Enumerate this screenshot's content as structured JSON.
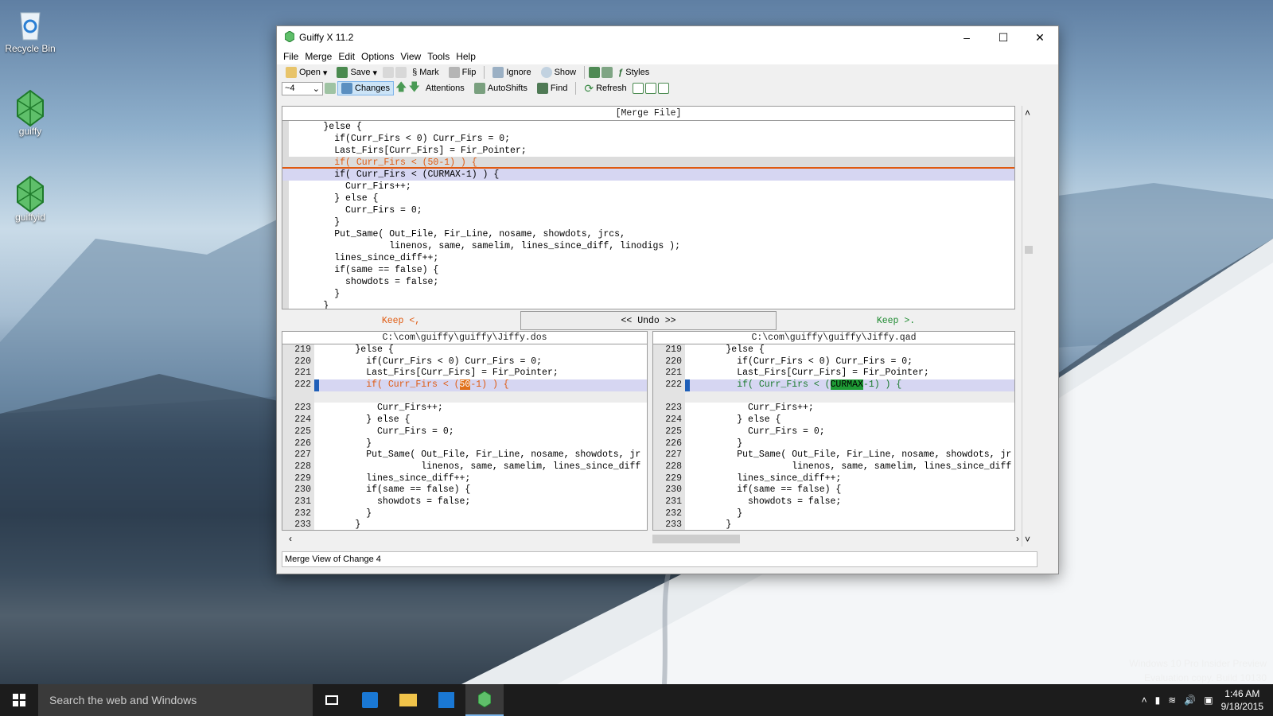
{
  "desktop": {
    "icons": [
      {
        "label": "Recycle Bin",
        "icon": "recycle-bin-icon"
      },
      {
        "label": "guiffy",
        "icon": "guiffy-icon"
      },
      {
        "label": "guiffyid",
        "icon": "guiffy-icon"
      }
    ],
    "watermark": [
      "Windows 10 Pro Insider Preview",
      "Evaluation copy. Build 10130"
    ]
  },
  "window": {
    "title": "Guiffy X 11.2",
    "menu": [
      "File",
      "Merge",
      "Edit",
      "Options",
      "View",
      "Tools",
      "Help"
    ],
    "toolbar1": {
      "open": "Open",
      "save": "Save",
      "mark": "Mark",
      "flip": "Flip",
      "ignore": "Ignore",
      "show": "Show",
      "styles": "Styles"
    },
    "toolbar2": {
      "change_select": "~4",
      "changes": "Changes",
      "attentions": "Attentions",
      "autoshifts": "AutoShifts",
      "find": "Find",
      "refresh": "Refresh"
    },
    "merge_header": "[Merge File]",
    "merge_lines": [
      "      }else {",
      "        if(Curr_Firs < 0) Curr_Firs = 0;",
      "        Last_Firs[Curr_Firs] = Fir_Pointer;",
      "        if( Curr_Firs < (50-1) ) {",
      "        if( Curr_Firs < (CURMAX-1) ) {",
      "          Curr_Firs++;",
      "        } else {",
      "          Curr_Firs = 0;",
      "        }",
      "        Put_Same( Out_File, Fir_Line, nosame, showdots, jrcs,",
      "                  linenos, same, samelim, lines_since_diff, linodigs );",
      "        lines_since_diff++;",
      "        if(same == false) {",
      "          showdots = false;",
      "        }",
      "      }"
    ],
    "keep_left": "Keep <,",
    "undo": "<< Undo >>",
    "keep_right": "Keep >.",
    "left_file": "C:\\com\\guiffy\\guiffy\\Jiffy.dos",
    "right_file": "C:\\com\\guiffy\\guiffy\\Jiffy.qad",
    "line_numbers": [
      "219",
      "220",
      "221",
      "222",
      "",
      "223",
      "224",
      "225",
      "226",
      "227",
      "228",
      "229",
      "230",
      "231",
      "232",
      "233"
    ],
    "left_lines": [
      "      }else {",
      "        if(Curr_Firs < 0) Curr_Firs = 0;",
      "        Last_Firs[Curr_Firs] = Fir_Pointer;",
      "        if( Curr_Firs < (",
      "",
      "          Curr_Firs++;",
      "        } else {",
      "          Curr_Firs = 0;",
      "        }",
      "        Put_Same( Out_File, Fir_Line, nosame, showdots, jr",
      "                  linenos, same, samelim, lines_since_diff",
      "        lines_since_diff++;",
      "        if(same == false) {",
      "          showdots = false;",
      "        }",
      "      }"
    ],
    "left_changed": {
      "pre": "        if( Curr_Firs < (",
      "hl": "50",
      "post": "-1) ) {"
    },
    "right_changed": {
      "pre": "        if( Curr_Firs < (",
      "hl": "CURMAX",
      "post": "-1) ) {"
    },
    "status": "Merge View of Change 4"
  },
  "taskbar": {
    "search_placeholder": "Search the web and Windows",
    "time": "1:46 AM",
    "date": "9/18/2015"
  },
  "colors": {
    "changed_bg": "#d6d6f2",
    "orange": "#e05a10",
    "green": "#1e9b35"
  }
}
